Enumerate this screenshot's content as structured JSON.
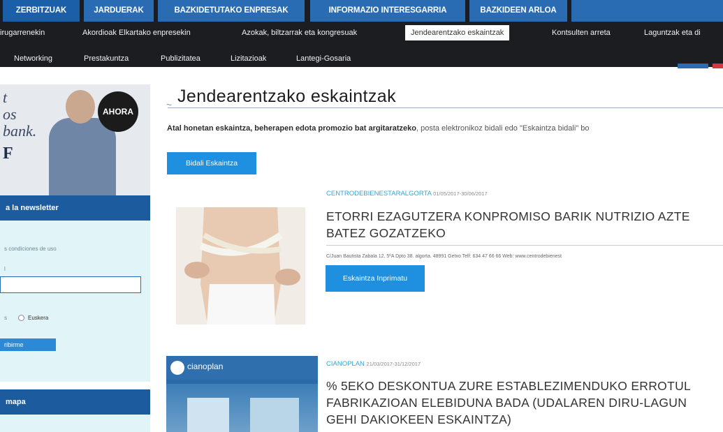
{
  "nav": {
    "tabs": [
      {
        "label": "ZERBITZUAK",
        "state": "active"
      },
      {
        "label": "JARDUERAK",
        "state": "blue"
      },
      {
        "label": "BAZKIDETUTAKO ENPRESAK",
        "state": "blue"
      },
      {
        "label": "INFORMAZIO INTERESGARRIA",
        "state": "blue"
      },
      {
        "label": "BAZKIDEEN ARLOA",
        "state": "blue"
      }
    ],
    "sub_row1": [
      "irugarrenekin",
      "Akordioak Elkartako enpresekin",
      "Azokak, biltzarrak eta kongresuak",
      "Jendearentzako eskaintzak",
      "Kontsulten arreta",
      "Laguntzak eta di"
    ],
    "sub_row2": [
      "Networking",
      "Prestakuntza",
      "Publizitatea",
      "Lizitazioak",
      "Lantegi-Gosaria"
    ],
    "selected_sub": "Jendearentzako eskaintzak"
  },
  "sidebar": {
    "ad": {
      "lines": [
        "t",
        "os",
        "bank.",
        "F"
      ],
      "badge": "AHORA"
    },
    "newsletter": {
      "header": "a la newsletter",
      "conditions": "s condiciones de uso",
      "field_label": "l",
      "language_left": "s",
      "language_right": "Euskera",
      "submit_label": "ribirme"
    },
    "sitemap": {
      "header": "mapa"
    }
  },
  "main": {
    "title": "Jendearentzako eskaintzak",
    "intro_bold": "Atal honetan eskaintza, beherapen edota promozio bat argitaratzeko",
    "intro_rest": ", posta elektronikoz bidali edo \"Eskaintza bidali\" bo",
    "send_button": "Bidali Eskaintza",
    "offers": [
      {
        "company": "CENTRODEBIENESTARALGORTA",
        "dates": "01/05/2017-30/06/2017",
        "title_lines": [
          "ETORRI EZAGUTZERA KONPROMISO BARIK NUTRIZIO AZTE",
          "BATEZ GOZATZEKO"
        ],
        "address": "C/Juan Bautista Zabala 12, 5ºA Dpto 38. algorta. 48991 Getxo Telf: 634 47 66 66 Web: www.centrodebienest",
        "print_button": "Eskaintza Inprimatu"
      },
      {
        "company": "CIANOPLAN",
        "dates": "21/03/2017-31/12/2017",
        "title_lines": [
          "% 5EKO DESKONTUA ZURE ESTABLEZIMENDUKO ERROTUL",
          "FABRIKAZIOAN ELEBIDUNA BADA (UDALAREN DIRU-LAGUN",
          "GEHI DAKIOKEEN ESKAINTZA)"
        ],
        "logo_text": "cianoplan"
      }
    ]
  },
  "colors": {
    "nav_bg": "#1c1d20",
    "nav_active": "#1a5fa8",
    "accent_blue": "#1f8fe0",
    "meta_blue": "#2fa6d8",
    "sidebar_panel": "#e1f4f8",
    "sidebar_header": "#1c5c9e"
  }
}
